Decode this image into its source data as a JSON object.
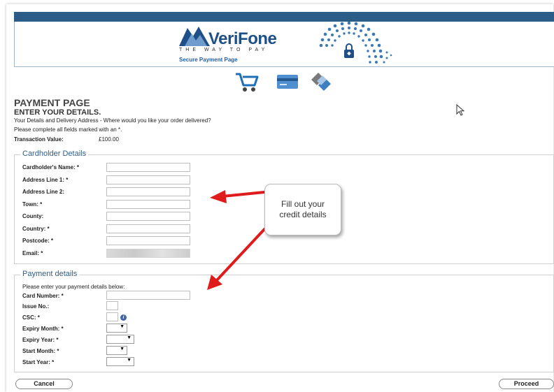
{
  "header": {
    "brand": "VeriFone",
    "tagline": "THE WAY TO PAY",
    "secure_label": "Secure Payment Page",
    "brand_color": "#1e4f86",
    "bar_color": "#2c5d86"
  },
  "steps": [
    {
      "icon": "shopping-cart-icon"
    },
    {
      "icon": "credit-card-icon"
    },
    {
      "icon": "handshake-icon"
    }
  ],
  "page": {
    "title": "PAYMENT PAGE",
    "subtitle": "ENTER YOUR DETAILS.",
    "info_line1": "Your Details and Delivery Address - Where would you like your order delivered?",
    "info_line2": "Please complete all fields marked with an *.",
    "transaction_label": "Transaction Value:",
    "transaction_value": "£100.00"
  },
  "cardholder": {
    "legend": "Cardholder Details",
    "fields": [
      {
        "label": "Cardholder's Name: *",
        "value": ""
      },
      {
        "label": "Address Line 1: *",
        "value": ""
      },
      {
        "label": "Address Line 2:",
        "value": ""
      },
      {
        "label": "Town: *",
        "value": ""
      },
      {
        "label": "County:",
        "value": ""
      },
      {
        "label": "Country: *",
        "value": ""
      },
      {
        "label": "Postcode: *",
        "value": ""
      },
      {
        "label": "Email: *",
        "value": ""
      }
    ]
  },
  "payment": {
    "legend": "Payment details",
    "note": "Please enter your payment details below:",
    "card_number_label": "Card Number: *",
    "issue_no_label": "Issue No.:",
    "csc_label": "CSC: *",
    "csc_info_glyph": "i",
    "expiry_month_label": "Expiry Month: *",
    "expiry_year_label": "Expiry Year: *",
    "start_month_label": "Start Month: *",
    "start_year_label": "Start Year: *",
    "select_arrow": "▼"
  },
  "buttons": {
    "cancel": "Cancel",
    "proceed": "Proceed"
  },
  "annotation": {
    "text_line1": "Fill out your",
    "text_line2": "credit details",
    "arrow_color": "#e01b1b"
  }
}
